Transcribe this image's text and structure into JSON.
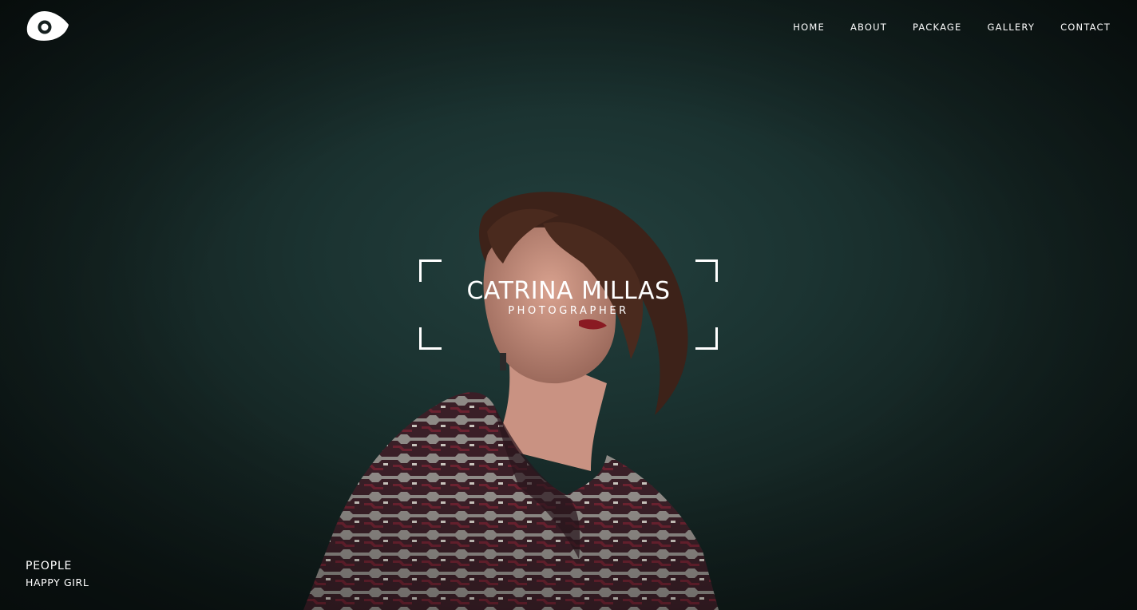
{
  "header": {
    "logo_icon": "eye-icon",
    "nav": [
      {
        "label": "HOME"
      },
      {
        "label": "ABOUT"
      },
      {
        "label": "PACKAGE"
      },
      {
        "label": "GALLERY"
      },
      {
        "label": "CONTACT"
      }
    ]
  },
  "hero": {
    "name": "CATRINA MILLAS",
    "role": "PHOTOGRAPHER"
  },
  "caption": {
    "category": "PEOPLE",
    "title": "HAPPY GIRL"
  },
  "colors": {
    "background": "#1b3331",
    "text": "#ffffff"
  }
}
